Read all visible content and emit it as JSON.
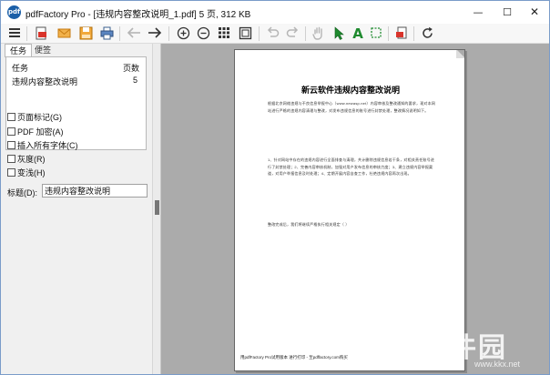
{
  "window": {
    "title": "pdfFactory Pro - [违规内容整改说明_1.pdf] 5 页, 312 KB",
    "controls": {
      "minimize": "—",
      "maximize": "☐",
      "close": "✕"
    }
  },
  "toolbar": {
    "items": [
      {
        "name": "menu-icon",
        "enabled": true
      },
      {
        "name": "pdf-save-icon",
        "enabled": true
      },
      {
        "name": "email-icon",
        "enabled": true
      },
      {
        "name": "save-icon",
        "enabled": true
      },
      {
        "name": "print-icon",
        "enabled": true
      },
      {
        "name": "back-arrow-icon",
        "enabled": false
      },
      {
        "name": "forward-arrow-icon",
        "enabled": true
      },
      {
        "name": "zoom-in-icon",
        "enabled": true
      },
      {
        "name": "zoom-out-icon",
        "enabled": true
      },
      {
        "name": "thumbnails-icon",
        "enabled": true
      },
      {
        "name": "fit-page-icon",
        "enabled": true
      },
      {
        "name": "undo-icon",
        "enabled": false
      },
      {
        "name": "redo-icon",
        "enabled": false
      },
      {
        "name": "hand-tool-icon",
        "enabled": false
      },
      {
        "name": "select-arrow-icon",
        "enabled": true
      },
      {
        "name": "text-tool-icon",
        "enabled": true
      },
      {
        "name": "crop-icon",
        "enabled": true
      },
      {
        "name": "delete-page-icon",
        "enabled": true
      },
      {
        "name": "refresh-icon",
        "enabled": true
      }
    ],
    "text_tool_label": "A"
  },
  "tabs": {
    "task": "任务",
    "note": "便签"
  },
  "task_list": {
    "header_task": "任务",
    "header_pages": "页数",
    "rows": [
      {
        "task": "违规内容整改说明",
        "pages": "5"
      }
    ]
  },
  "options": {
    "page_marks": "页面标记(G)",
    "pdf_encrypt": "PDF 加密(A)",
    "embed_fonts": "插入所有字体(C)",
    "grayscale": "灰度(R)",
    "shrink": "变浅(H)"
  },
  "doc_title_field": {
    "label": "标题(D):",
    "value": "违规内容整改说明"
  },
  "document": {
    "title": "新云软件违规内容整改说明",
    "para1": "根据北京网络违规与不良信息举报中心（www.newasp.net）内容审核及整改通知的要求，现对本网站进行严格的违规内容清理与整改，对发布违规信息的账号进行封禁处理，整改情况说明如下。",
    "para2": "1、针对网站中存在的违规内容进行全面排查与清理，共计删除违规信息若干条，对相关责任账号进行了封禁处理；2、完善内容审核机制，加强对用户发布信息的审核力度；3、建立违规内容举报渠道，对用户举报信息及时处理；4、定期开展内容自查工作，杜绝违规内容再次出现。",
    "para3": "整改完成后，我们将继续严格执行相关规定（  ）",
    "footer": "用pdfFactory Pro试用版本 进行打印 - 至pdffactory.com购买"
  },
  "watermark": {
    "text": "人人软件园",
    "url": "www.kkx.net"
  }
}
